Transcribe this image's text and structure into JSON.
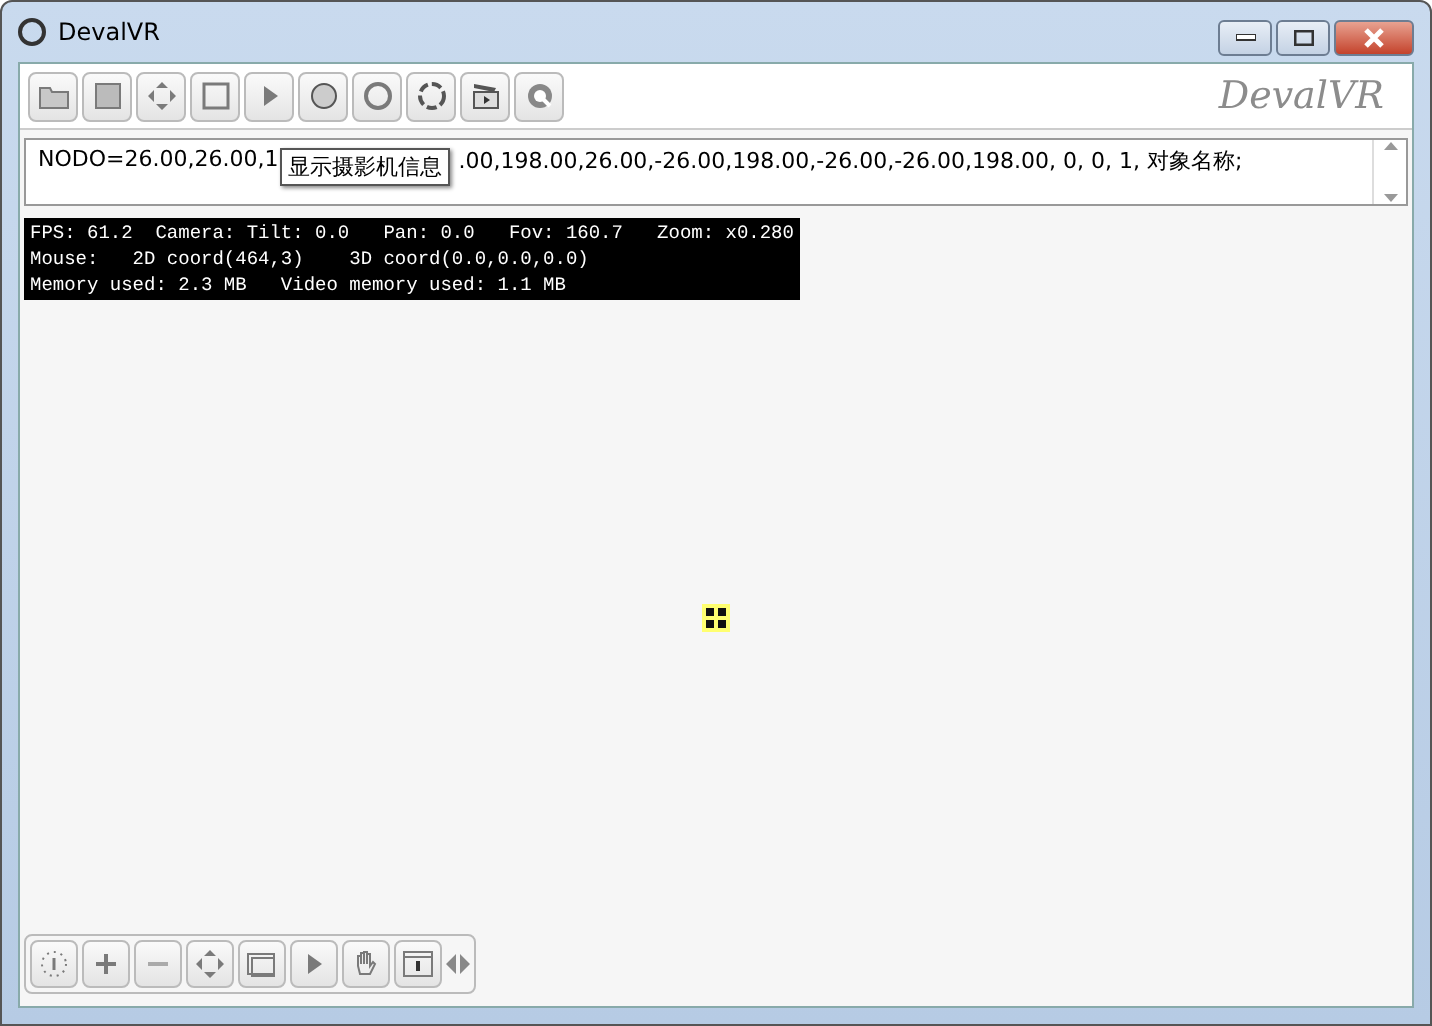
{
  "window": {
    "title": "DevalVR"
  },
  "toolbar": {
    "buttons": [
      {
        "kind": "open"
      },
      {
        "kind": "save"
      },
      {
        "kind": "move"
      },
      {
        "kind": "frame"
      },
      {
        "kind": "play"
      },
      {
        "kind": "sphere"
      },
      {
        "kind": "ring"
      },
      {
        "kind": "dotted-ring"
      },
      {
        "kind": "clapper"
      },
      {
        "kind": "q"
      }
    ],
    "logo": "DevalVR"
  },
  "command_field": {
    "value_start": "NODO=26.00,26.00,1",
    "value_end": ".00,198.00,26.00,-26.00,198.00,-26.00,-26.00,198.00, 0, 0, 1, 对象名称;"
  },
  "tooltip": "显示摄影机信息",
  "info_lines": [
    "FPS: 61.2  Camera: Tilt: 0.0   Pan: 0.0   Fov: 160.7   Zoom: x0.280",
    "Mouse:   2D coord(464,3)    3D coord(0.0,0.0,0.0)",
    "Memory used: 2.3 MB   Video memory used: 1.1 MB"
  ],
  "bottom_toolbar": [
    {
      "kind": "dots"
    },
    {
      "kind": "plus"
    },
    {
      "kind": "minus"
    },
    {
      "kind": "arrows"
    },
    {
      "kind": "window"
    },
    {
      "kind": "play"
    },
    {
      "kind": "hand"
    },
    {
      "kind": "info"
    }
  ]
}
